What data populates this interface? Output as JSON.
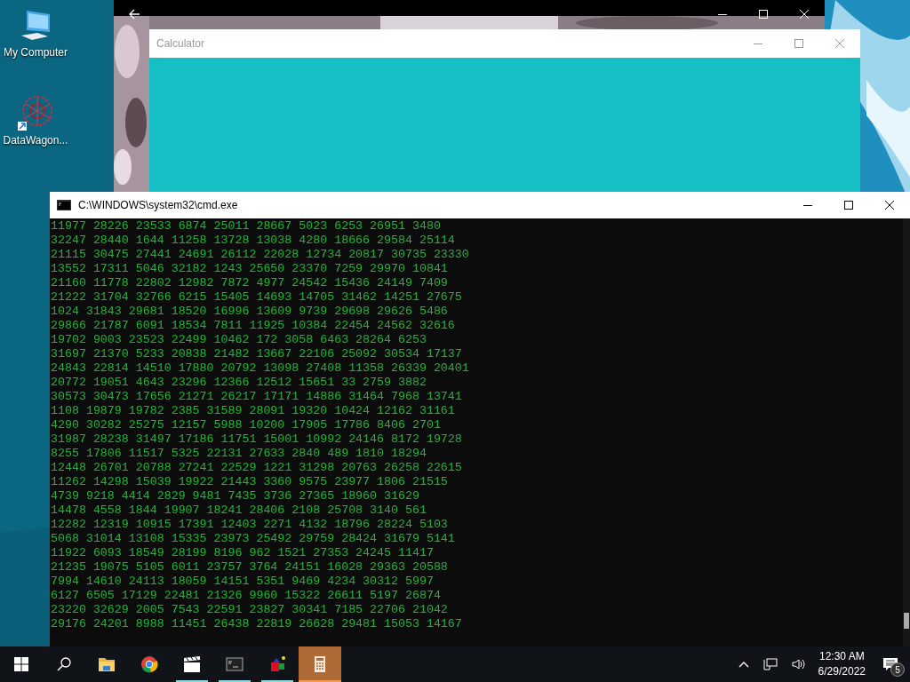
{
  "desktop_icons": [
    {
      "label": "My Computer",
      "kind": "computer"
    },
    {
      "label": "DataWagon...",
      "kind": "shortcut"
    }
  ],
  "calculator": {
    "title": "Calculator"
  },
  "console": {
    "title": "C:\\WINDOWS\\system32\\cmd.exe",
    "lines": [
      "11977 28226 23533 6874 25011 28667 5023 6253 26951 3480",
      "32247 28440 1644 11258 13728 13038 4280 18666 29584 25114",
      "21115 30475 27441 24691 26112 22028 12734 20817 30735 23330",
      "13552 17311 5046 32182 1243 25650 23370 7259 29970 10841",
      "21160 11778 22802 12982 7872 4977 24542 15436 24149 7409",
      "21222 31704 32766 6215 15405 14693 14705 31462 14251 27675",
      "1024 31843 29681 18520 16996 13609 9739 29698 29626 5486",
      "29866 21787 6091 18534 7811 11925 10384 22454 24562 32616",
      "19702 9003 23523 22499 10462 172 3058 6463 28264 6253",
      "31697 21370 5233 20838 21482 13667 22106 25092 30534 17137",
      "24843 22814 14510 17880 20792 13098 27408 11358 26339 20401",
      "20772 19051 4643 23296 12366 12512 15651 33 2759 3882",
      "30573 30473 17656 21271 26217 17171 14886 31464 7968 13741",
      "1108 19879 19782 2385 31589 28091 19320 10424 12162 31161",
      "4290 30282 25275 12157 5988 10200 17905 17786 8406 2701",
      "31987 28238 31497 17186 11751 15001 10992 24146 8172 19728",
      "8255 17806 11517 5325 22131 27633 2840 489 1810 18294",
      "12448 26701 20788 27241 22529 1221 31298 20763 26258 22615",
      "11262 14298 15039 19922 21443 3360 9575 23977 1806 21515",
      "4739 9218 4414 2829 9481 7435 3736 27365 18960 31629",
      "14478 4558 1844 19907 18241 28406 2108 25708 3140 561",
      "12282 12319 10915 17391 12403 2271 4132 18796 28224 5103",
      "5068 31014 13108 15335 23973 25492 29759 28424 31679 5141",
      "11922 6093 18549 28199 8196 962 1521 27353 24245 11417",
      "21235 19075 5105 6011 23757 3764 24151 16028 29363 20588",
      "7994 14610 24113 18059 14151 5351 9469 4234 30312 5997",
      "6127 6505 17129 22481 21326 9960 15322 26611 5197 26874",
      "23220 32629 2005 7543 22591 23827 30341 7185 22706 21042",
      "29176 24201 8988 11451 26438 22819 26628 29481 15053 14167"
    ]
  },
  "taskbar": {
    "apps": [
      {
        "kind": "folder",
        "running": false,
        "selected": false
      },
      {
        "kind": "browser",
        "running": false,
        "selected": false
      },
      {
        "kind": "clapper",
        "running": true,
        "selected": false
      },
      {
        "kind": "console",
        "running": true,
        "selected": false
      },
      {
        "kind": "shapes",
        "running": true,
        "selected": false
      },
      {
        "kind": "calculator",
        "running": true,
        "selected": true
      }
    ],
    "time": "12:30 AM",
    "date": "6/29/2022",
    "notifications": "5"
  }
}
